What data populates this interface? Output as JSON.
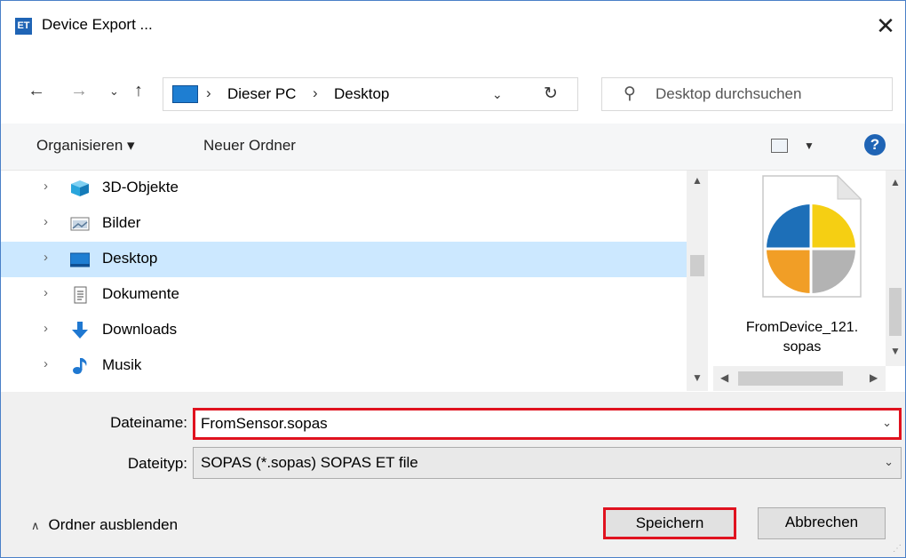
{
  "window": {
    "title": "Device Export ...",
    "app_icon_label": "ET"
  },
  "address": {
    "segments": [
      "Dieser PC",
      "Desktop"
    ],
    "search_placeholder": "Desktop durchsuchen"
  },
  "toolbar": {
    "organize": "Organisieren ▾",
    "new_folder": "Neuer Ordner"
  },
  "nav_tree": {
    "items": [
      {
        "label": "3D-Objekte",
        "icon": "3d-objects-icon"
      },
      {
        "label": "Bilder",
        "icon": "pictures-icon"
      },
      {
        "label": "Desktop",
        "icon": "desktop-icon",
        "selected": true
      },
      {
        "label": "Dokumente",
        "icon": "documents-icon"
      },
      {
        "label": "Downloads",
        "icon": "downloads-icon"
      },
      {
        "label": "Musik",
        "icon": "music-icon"
      }
    ]
  },
  "file_pane": {
    "file": {
      "name_line1": "FromDevice_121.",
      "name_line2": "sopas"
    }
  },
  "form": {
    "filename_label": "Dateiname:",
    "filename_value": "FromSensor.sopas",
    "filetype_label": "Dateityp:",
    "filetype_value": "SOPAS (*.sopas) SOPAS ET file"
  },
  "footer": {
    "hide_folders": "Ordner ausblenden",
    "save": "Speichern",
    "cancel": "Abbrechen"
  },
  "colors": {
    "highlight_red": "#e0121f",
    "selection": "#cce8ff",
    "accent": "#1f64b5"
  }
}
